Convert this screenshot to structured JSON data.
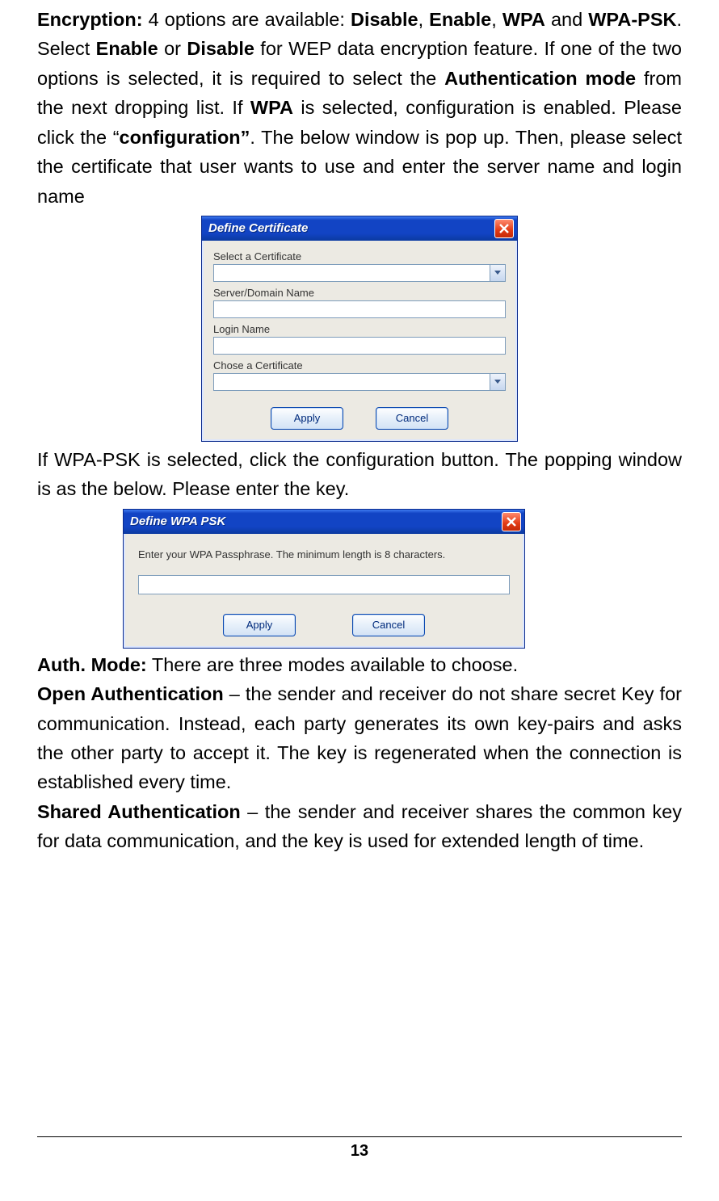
{
  "para1_parts": {
    "p1": "Encryption:",
    "p2": " 4 options are available: ",
    "p3": "Disable",
    "p4": ", ",
    "p5": "Enable",
    "p6": ", ",
    "p7": "WPA",
    "p8": " and ",
    "p9": "WPA-PSK",
    "p10": ". Select ",
    "p11": "Enable",
    "p12": " or ",
    "p13": "Disable",
    "p14": " for WEP data encryption feature.   If one of the two options is selected, it is required to select the ",
    "p15": "Authentication mode",
    "p16": " from the next dropping list.   If ",
    "p17": "WPA",
    "p18": " is selected, configuration is enabled.   Please click the “",
    "p19": "configuration”",
    "p20": ". The below window is pop up. Then, please select the certificate that user wants to use and enter the server name and login name"
  },
  "cert_dialog": {
    "title": "Define Certificate",
    "labels": {
      "select_cert": "Select a Certificate",
      "server_domain": "Server/Domain Name",
      "login_name": "Login Name",
      "chose_cert": "Chose a Certificate"
    },
    "apply": "Apply",
    "cancel": "Cancel"
  },
  "para2": "If WPA-PSK is selected, click the configuration button.   The popping window is as the below. Please enter the key.",
  "psk_dialog": {
    "title": "Define WPA PSK",
    "hint": "Enter your WPA Passphrase.   The minimum length is 8 characters.",
    "apply": "Apply",
    "cancel": "Cancel"
  },
  "auth_mode": {
    "lead_b": "Auth. Mode:",
    "lead_t": " There are three modes available to choose.",
    "open_b": " Open Authentication",
    "open_t": " – the sender and receiver do not share secret Key for communication. Instead, each party generates its own key-pairs and asks the other party to accept it. The key is regenerated when the connection is established every time.",
    "shared_b": " Shared Authentication",
    "shared_t": " – the sender and receiver shares the common key for data communication, and the key is used for extended length of time."
  },
  "page_number": "13"
}
